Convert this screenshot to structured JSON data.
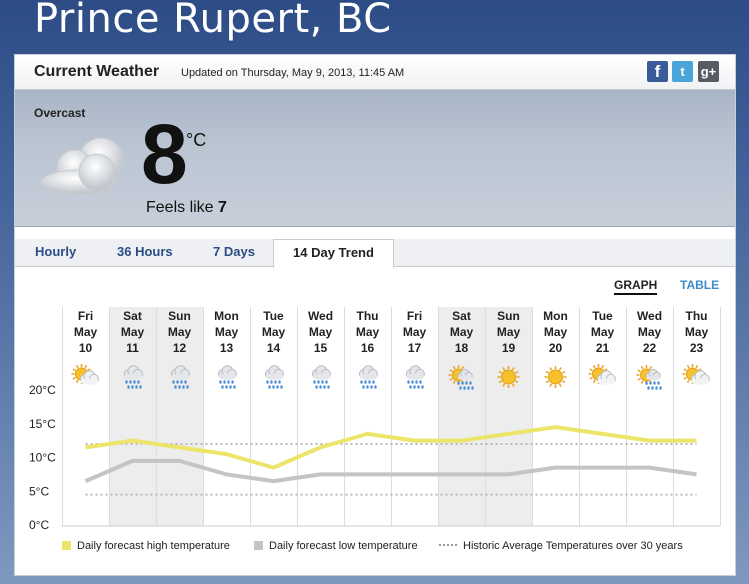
{
  "location": {
    "title": "Prince Rupert, BC"
  },
  "header": {
    "title": "Current Weather",
    "updated": "Updated on Thursday, May 9, 2013, 11:45 AM",
    "social": {
      "facebook": "f",
      "twitter": "t",
      "google": "g+"
    }
  },
  "current": {
    "condition": "Overcast",
    "temperature": "8",
    "unit": "°C",
    "feels_label": "Feels like",
    "feels_value": "7"
  },
  "tabs": [
    {
      "label": "Hourly"
    },
    {
      "label": "36 Hours"
    },
    {
      "label": "7 Days"
    },
    {
      "label": "14 Day Trend",
      "active": true
    }
  ],
  "view_toggle": {
    "graph": "GRAPH",
    "table": "TABLE",
    "selected": "GRAPH"
  },
  "chart_data": {
    "type": "line",
    "x": [
      {
        "dow": "Fri",
        "month": "May",
        "day": "10",
        "icon": "sun-cloud-icon"
      },
      {
        "dow": "Sat",
        "month": "May",
        "day": "11",
        "icon": "rain-cloud-icon"
      },
      {
        "dow": "Sun",
        "month": "May",
        "day": "12",
        "icon": "rain-cloud-icon"
      },
      {
        "dow": "Mon",
        "month": "May",
        "day": "13",
        "icon": "rain-cloud-icon"
      },
      {
        "dow": "Tue",
        "month": "May",
        "day": "14",
        "icon": "rain-cloud-icon"
      },
      {
        "dow": "Wed",
        "month": "May",
        "day": "15",
        "icon": "rain-cloud-icon"
      },
      {
        "dow": "Thu",
        "month": "May",
        "day": "16",
        "icon": "rain-cloud-icon"
      },
      {
        "dow": "Fri",
        "month": "May",
        "day": "17",
        "icon": "rain-cloud-icon"
      },
      {
        "dow": "Sat",
        "month": "May",
        "day": "18",
        "icon": "sun-rain-icon"
      },
      {
        "dow": "Sun",
        "month": "May",
        "day": "19",
        "icon": "sun-icon"
      },
      {
        "dow": "Mon",
        "month": "May",
        "day": "20",
        "icon": "sun-icon"
      },
      {
        "dow": "Tue",
        "month": "May",
        "day": "21",
        "icon": "sun-cloud-icon"
      },
      {
        "dow": "Wed",
        "month": "May",
        "day": "22",
        "icon": "sun-rain-icon"
      },
      {
        "dow": "Thu",
        "month": "May",
        "day": "23",
        "icon": "sun-cloud-icon"
      }
    ],
    "weekend_shaded": [
      1,
      2,
      8,
      9
    ],
    "y_ticks": [
      "20°C",
      "15°C",
      "10°C",
      "5°C",
      "0°C"
    ],
    "ylim": [
      0,
      20
    ],
    "series": [
      {
        "name": "Daily forecast high temperature",
        "color": "#ece56a",
        "values": [
          11.5,
          12.5,
          11.5,
          10.5,
          8.5,
          11.5,
          13.5,
          12.5,
          12.5,
          13.5,
          14.5,
          13.5,
          12.5,
          12.5
        ]
      },
      {
        "name": "Daily forecast low temperature",
        "color": "#c4c4c4",
        "values": [
          6.5,
          9.5,
          9.5,
          7.5,
          6.5,
          7.5,
          7.5,
          7.5,
          7.5,
          7.5,
          8.5,
          8.5,
          8.5,
          7.5
        ]
      },
      {
        "name": "Historic Average Temperatures over 30 years",
        "color": "#b8b8b8",
        "style": "dotted",
        "values_high": [
          12,
          12,
          12,
          12,
          12,
          12,
          12,
          12,
          12,
          12,
          12,
          12,
          12,
          12
        ],
        "values_low": [
          4.5,
          4.5,
          4.5,
          4.5,
          4.5,
          4.5,
          4.5,
          4.5,
          4.5,
          4.5,
          4.5,
          4.5,
          4.5,
          4.5
        ]
      }
    ],
    "grid": true
  }
}
